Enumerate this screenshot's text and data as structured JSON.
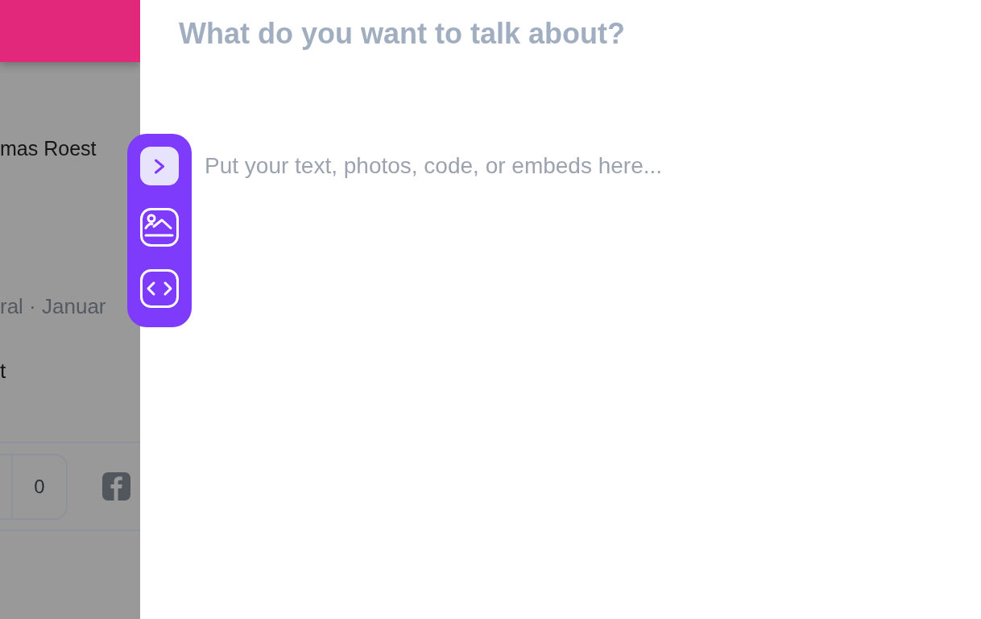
{
  "background_page": {
    "author": "mas Roest",
    "meta": "ral · Januar",
    "body": "t",
    "reaction_count": "0"
  },
  "editor": {
    "title_field": {
      "placeholder": "What do you want to talk about?"
    },
    "body_field": {
      "placeholder": "Put your text, photos, code, or embeds here..."
    },
    "toolbar": [
      {
        "kind": "expand"
      },
      {
        "kind": "image"
      },
      {
        "kind": "code"
      }
    ]
  }
}
